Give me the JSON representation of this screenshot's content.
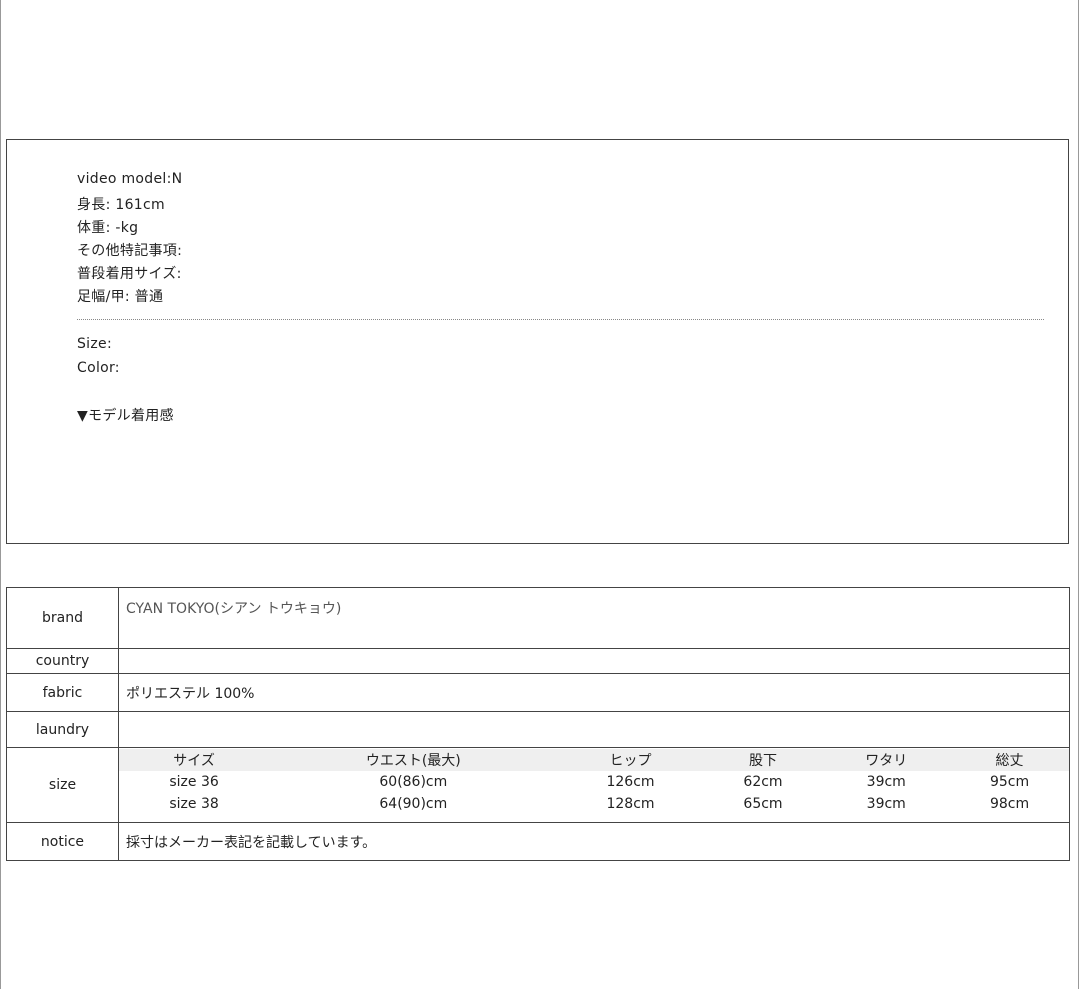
{
  "model": {
    "lines": [
      "video model:N",
      "身長: 161cm",
      "体重: -kg",
      "その他特記事項:",
      "普段着用サイズ:",
      "足幅/甲: 普通"
    ],
    "size_label": "Size:",
    "color_label": "Color:",
    "fit_heading": "▼モデル着用感"
  },
  "spec": {
    "brand": {
      "label": "brand",
      "value": "CYAN TOKYO(シアン トウキョウ)"
    },
    "country": {
      "label": "country",
      "value": ""
    },
    "fabric": {
      "label": "fabric",
      "value": "ポリエステル 100%"
    },
    "laundry": {
      "label": "laundry",
      "value": ""
    },
    "size": {
      "label": "size",
      "headers": [
        "サイズ",
        "ウエスト(最大)",
        "ヒップ",
        "股下",
        "ワタリ",
        "総丈"
      ],
      "rows": [
        [
          "size 36",
          "60(86)cm",
          "126cm",
          "62cm",
          "39cm",
          "95cm"
        ],
        [
          "size 38",
          "64(90)cm",
          "128cm",
          "65cm",
          "39cm",
          "98cm"
        ]
      ]
    },
    "notice": {
      "label": "notice",
      "value": "採寸はメーカー表記を記載しています。"
    }
  }
}
